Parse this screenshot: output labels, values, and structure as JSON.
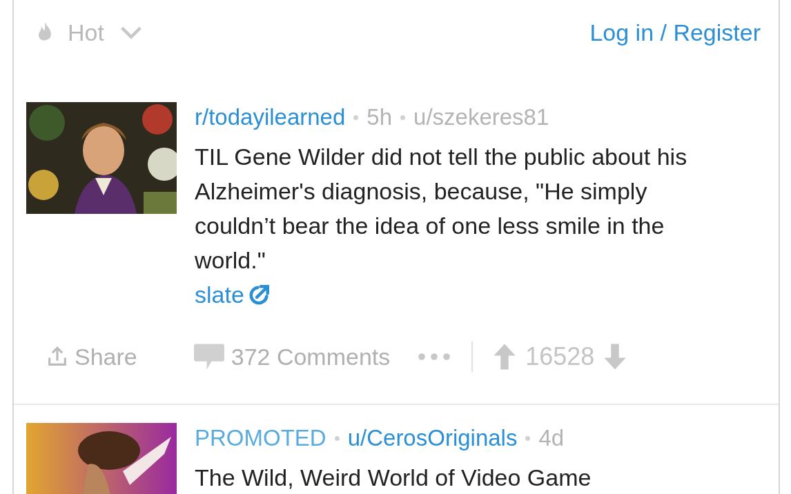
{
  "header": {
    "sort": {
      "label": "Hot"
    },
    "login": "Log in / Register"
  },
  "posts": [
    {
      "kind": "post",
      "meta": [
        {
          "kind": "link",
          "text": "r/todayilearned"
        },
        {
          "kind": "text",
          "text": "5h"
        },
        {
          "kind": "text",
          "text": "u/szekeres81"
        }
      ],
      "title": "TIL Gene Wilder did not tell the public about his Alzheimer's diagnosis, because, \"He simply couldn’t bear the idea of one less smile in the world.\"",
      "domain": "slate",
      "actions": {
        "share": "Share",
        "comments": "372 Comments",
        "score": "16528"
      }
    },
    {
      "kind": "promoted",
      "meta": [
        {
          "kind": "tag",
          "text": "PROMOTED"
        },
        {
          "kind": "link",
          "text": "u/CerosOriginals"
        },
        {
          "kind": "text",
          "text": "4d"
        }
      ],
      "title": "The Wild, Weird World of Video Game"
    }
  ]
}
